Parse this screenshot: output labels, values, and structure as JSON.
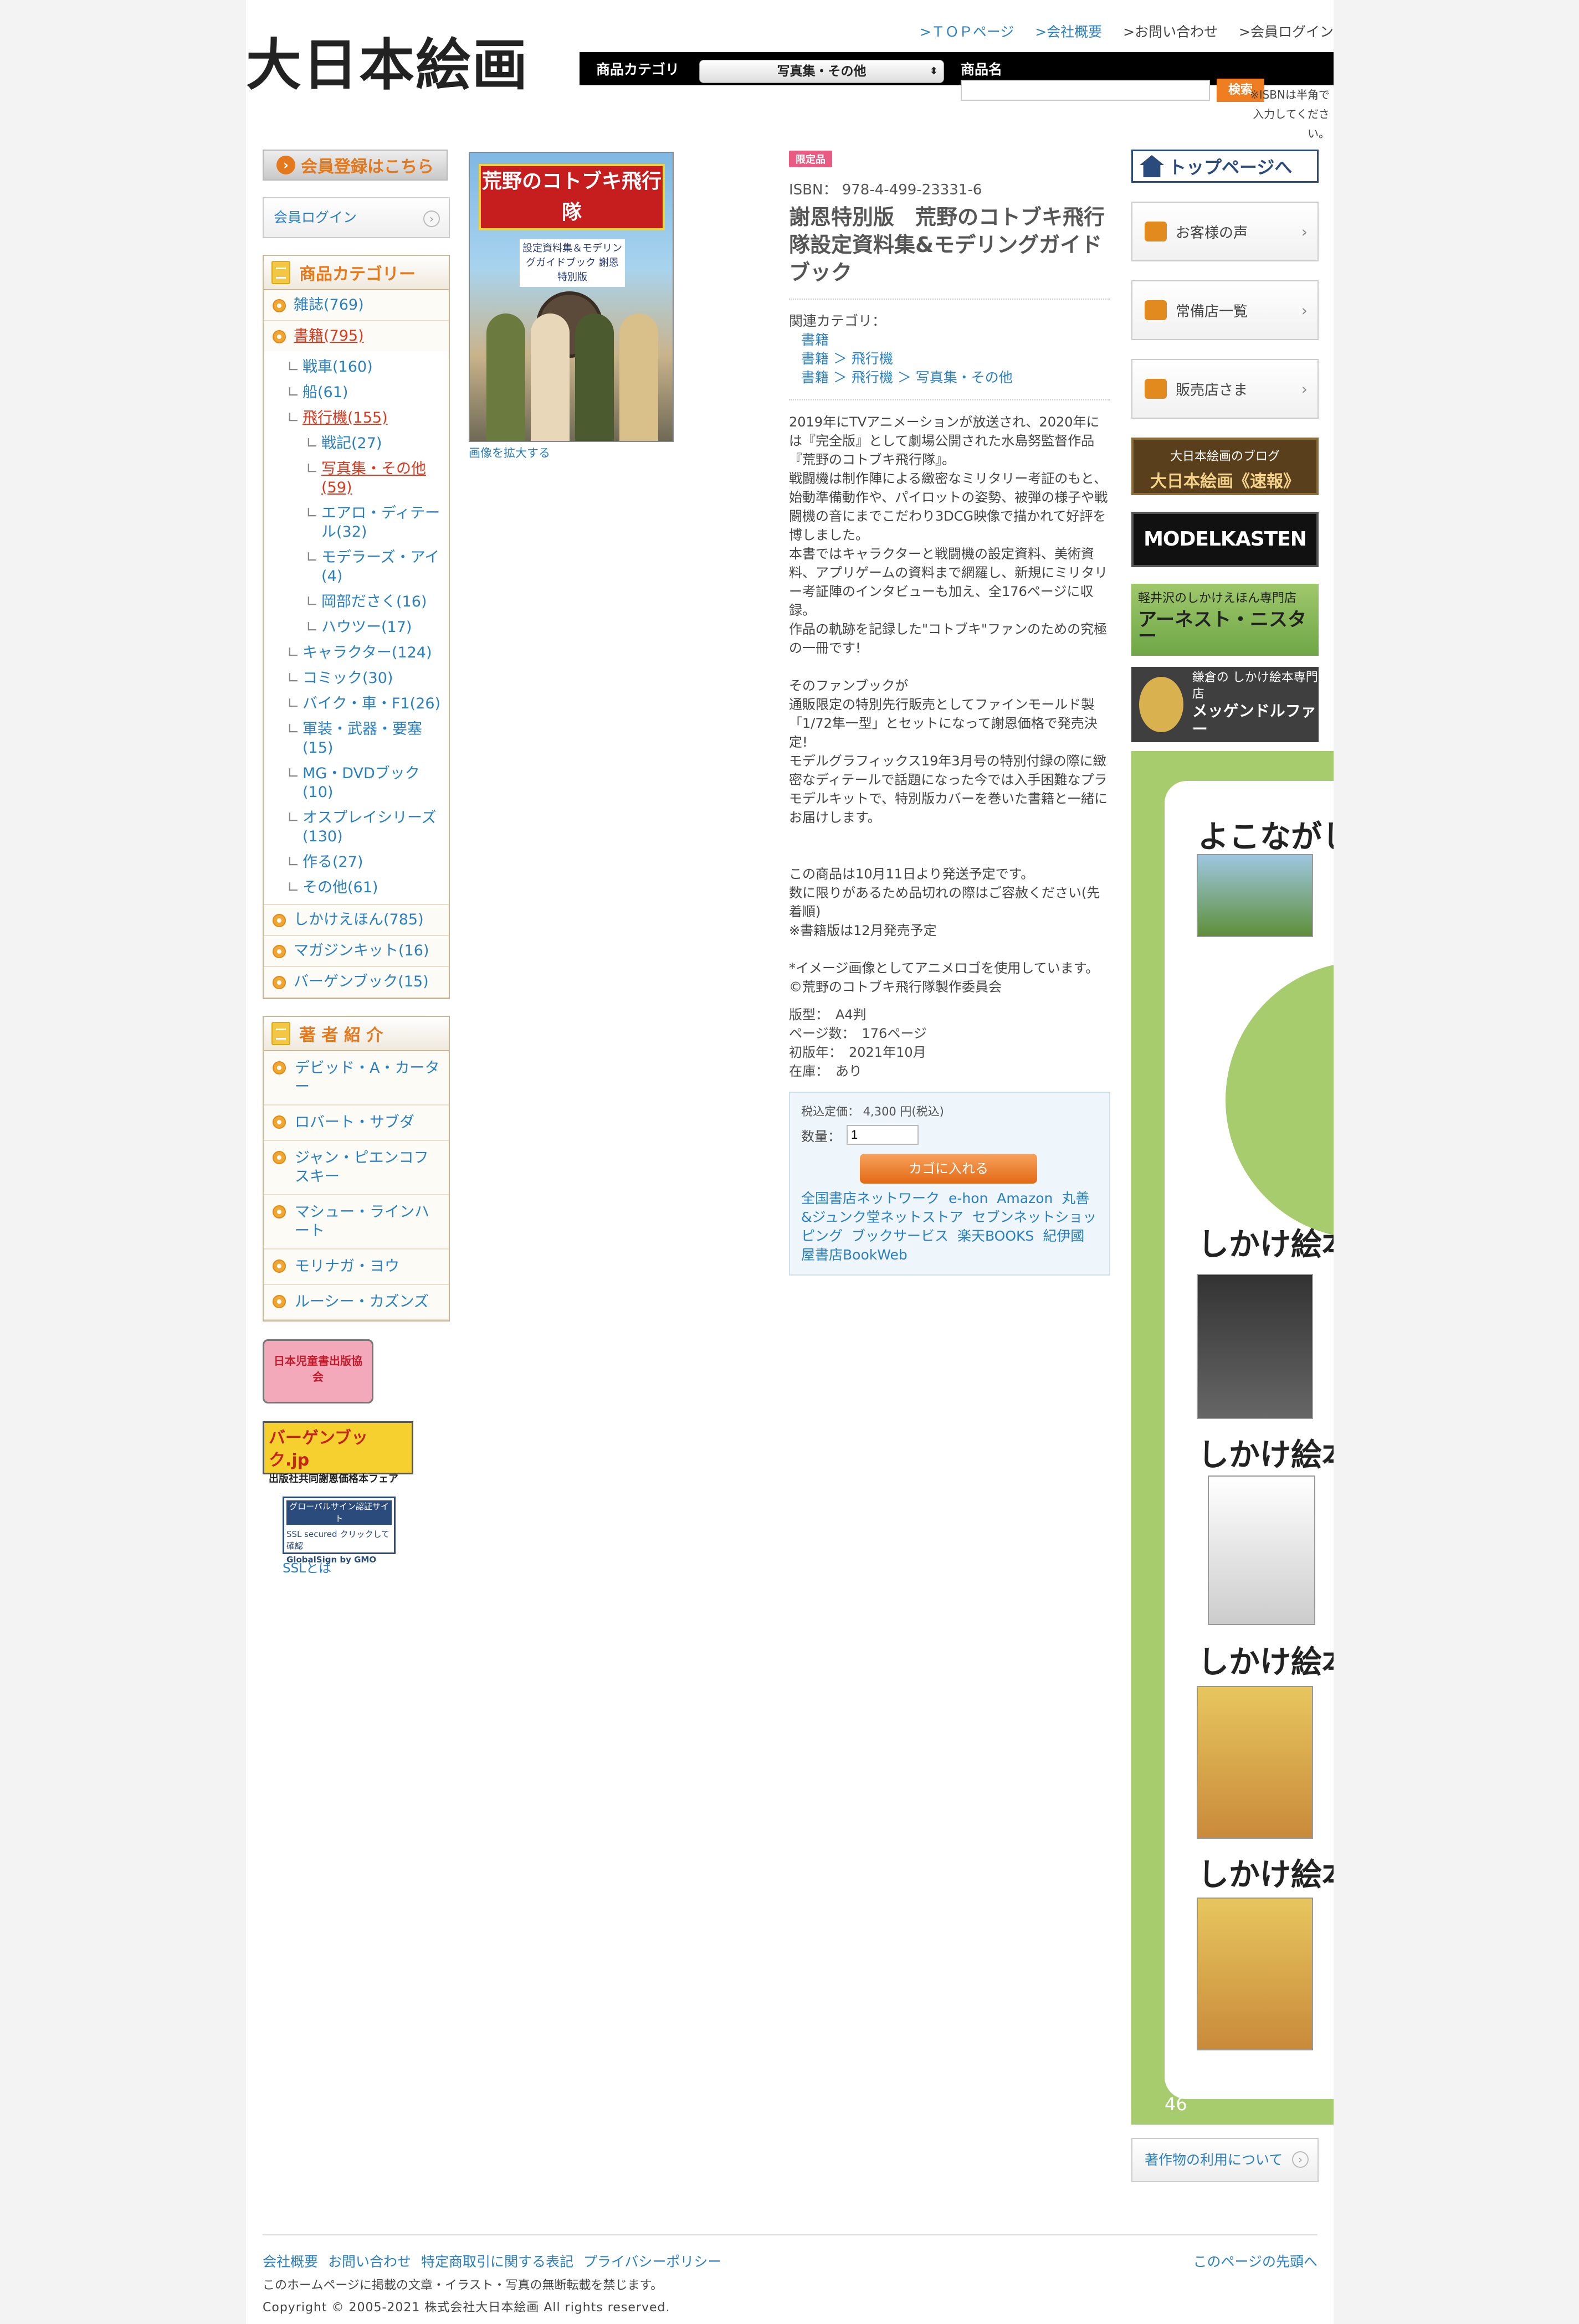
{
  "header": {
    "logo": "大日本絵画",
    "links": [
      ">ＴＯＰページ",
      ">会社概要",
      ">お問い合わせ",
      ">会員ログイン"
    ],
    "category_label": "商品カテゴリ",
    "category_value": "写真集・その他",
    "product_label": "商品名",
    "product_placeholder": "",
    "search_label": "検索",
    "isbn_note": "※ISBNは半角で入力してください。"
  },
  "sidebar": {
    "register_banner": "会員登録はこちら",
    "login": "会員ログイン",
    "categories_heading": "商品カテゴリー",
    "categories": [
      {
        "label": "雑誌(769)"
      },
      {
        "label": "書籍(795)"
      }
    ],
    "book_subs": [
      {
        "label": "戦車(160)",
        "level": 1
      },
      {
        "label": "船(61)",
        "level": 1
      },
      {
        "label": "飛行機(155)",
        "level": 1
      },
      {
        "label": "戦記(27)",
        "level": 2
      },
      {
        "label": "写真集・その他(59)",
        "level": 2
      },
      {
        "label": "エアロ・ディテール(32)",
        "level": 2
      },
      {
        "label": "モデラーズ・アイ(4)",
        "level": 2
      },
      {
        "label": "岡部ださく(16)",
        "level": 2
      },
      {
        "label": "ハウツー(17)",
        "level": 2
      },
      {
        "label": "キャラクター(124)",
        "level": 1
      },
      {
        "label": "コミック(30)",
        "level": 1
      },
      {
        "label": "バイク・車・F1(26)",
        "level": 1
      },
      {
        "label": "軍装・武器・要塞(15)",
        "level": 1
      },
      {
        "label": "MG・DVDブック(10)",
        "level": 1
      },
      {
        "label": "オスプレイシリーズ(130)",
        "level": 1
      },
      {
        "label": "作る(27)",
        "level": 1
      },
      {
        "label": "その他(61)",
        "level": 1
      }
    ],
    "categories_after": [
      {
        "label": "しかけえほん(785)"
      },
      {
        "label": "マガジンキット(16)"
      },
      {
        "label": "バーゲンブック(15)"
      }
    ],
    "authors_heading": "著 者 紹 介",
    "authors": [
      "デビッド・A・カーター",
      "ロバート・サブダ",
      "ジャン・ピエンコフスキー",
      "マシュー・ラインハート",
      "モリナガ・ヨウ",
      "ルーシー・カズンズ"
    ],
    "kids_banner": "日本児童書出版協会",
    "bargain_banner": "バーゲンブック.jp",
    "bargain_sub": "出版社共同謝恩価格本フェア",
    "globalsign_top": "グローバルサイン認証サイト",
    "globalsign_mid": "SSL secured クリックして確認",
    "globalsign_bottom": "GlobalSign by GMO",
    "ssl_link": "SSLとは"
  },
  "product": {
    "enlarge": "画像を拡大する",
    "cover_title": "荒野のコトブキ飛行隊",
    "cover_sub": "設定資料集＆モデリングガイドブック 謝恩特別版",
    "badge": "限定品",
    "isbn": "ISBN： 978-4-499-23331-6",
    "title": "謝恩特別版　荒野のコトブキ飛行隊設定資料集&モデリングガイドブック",
    "related_label": "関連カテゴリ：",
    "related": [
      "書籍",
      "書籍 ＞ 飛行機",
      "書籍 ＞ 飛行機 ＞ 写真集・その他"
    ],
    "description": "2019年にTVアニメーションが放送され、2020年には『完全版』として劇場公開された水島努監督作品『荒野のコトブキ飛行隊』。\n戦闘機は制作陣による緻密なミリタリー考証のもと、始動準備動作や、パイロットの姿勢、被弾の様子や戦闘機の音にまでこだわり3DCG映像で描かれて好評を博しました。\n本書ではキャラクターと戦闘機の設定資料、美術資料、アプリゲームの資料まで網羅し、新規にミリタリー考証陣のインタビューも加え、全176ページに収録。\n作品の軌跡を記録した\"コトブキ\"ファンのための究極の一冊です!\n\nそのファンブックが\n通販限定の特別先行販売としてファインモールド製「1/72隼一型」とセットになって謝恩価格で発売決定!\nモデルグラフィックス19年3月号の特別付録の際に緻密なディテールで話題になった今では入手困難なプラモデルキットで、特別版カバーを巻いた書籍と一緒にお届けします。\n\n\nこの商品は10月11日より発送予定です。\n数に限りがあるため品切れの際はご容赦ください(先着順)\n※書籍版は12月発売予定\n\n*イメージ画像としてアニメロゴを使用しています。\n©荒野のコトブキ飛行隊製作委員会",
    "specs": [
      "版型：　A4判",
      "ページ数：　176ページ",
      "初版年：　2021年10月",
      "在庫：　あり"
    ],
    "price": "税込定価： 4,300 円(税込)",
    "qty_label": "数量：",
    "qty": "1",
    "cart": "カゴに入れる",
    "shops": [
      "全国書店ネットワーク e-hon",
      "Amazon",
      "丸善&ジュンク堂ネットストア",
      "セブンネットショッピング",
      "ブックサービス",
      "楽天BOOKS",
      "紀伊國屋書店BookWeb"
    ]
  },
  "right": {
    "top": "トップページへ",
    "voice": "お客様の声",
    "stores": "常備店一覧",
    "sellers": "販売店さま",
    "blog_sub": "大日本絵画のブログ",
    "blog_main": "大日本絵画《速報》",
    "modelkasten": "MODELKASTEN",
    "nest_sub": "軽井沢のしかけえほん専門店",
    "nest_main": "アーネスト・ニスター",
    "meg_sub": "鎌倉の しかけ絵本専門店",
    "meg_main": "メッゲンドルファー",
    "ad_heads": [
      "よこながし",
      "しかけ絵本",
      "しかけ絵本の",
      "しかけ絵本",
      "しかけ絵本"
    ],
    "page_num": "46",
    "copyright_btn": "著作物の利用について"
  },
  "footer": {
    "links": [
      "会社概要",
      "お問い合わせ",
      "特定商取引に関する表記",
      "プライバシーポリシー"
    ],
    "pagetop": "このページの先頭へ",
    "note": "このホームページに掲載の文章・イラスト・写真の無断転載を禁じます。",
    "copyright": "Copyright © 2005-2021 株式会社大日本絵画 All rights reserved."
  }
}
